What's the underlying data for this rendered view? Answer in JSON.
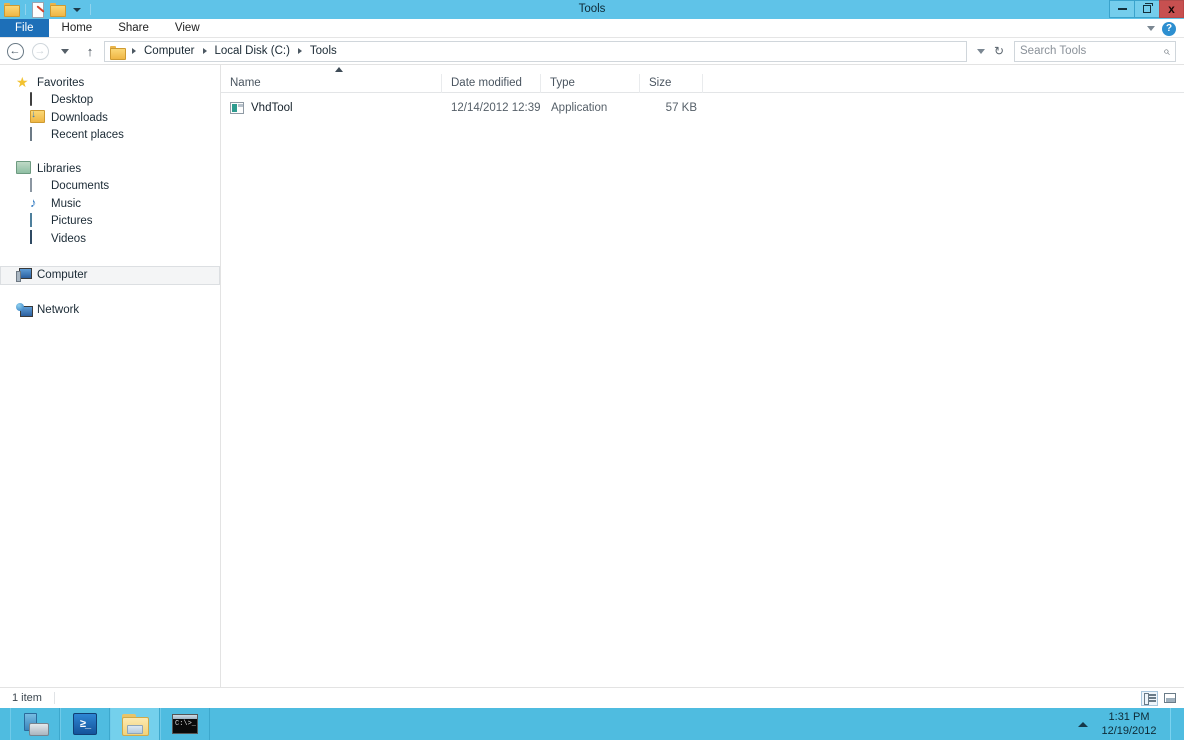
{
  "window": {
    "title": "Tools",
    "quick_access": [
      {
        "name": "folder-icon",
        "label": "Folder"
      },
      {
        "name": "properties-icon",
        "label": "Properties"
      },
      {
        "name": "new-folder-icon",
        "label": "New folder"
      },
      {
        "name": "customize-chevron-icon",
        "label": "Customize Quick Access Toolbar"
      }
    ],
    "controls": {
      "minimize": "—",
      "maximize": "▢",
      "close": "x"
    }
  },
  "ribbon": {
    "tabs": [
      {
        "label": "File",
        "active": true
      },
      {
        "label": "Home",
        "active": false
      },
      {
        "label": "Share",
        "active": false
      },
      {
        "label": "View",
        "active": false
      }
    ],
    "collapse_icon": "chevron-down-icon",
    "help_label": "?"
  },
  "address": {
    "back_label": "←",
    "forward_label": "→",
    "recent_label": "recent-locations-chevron",
    "up_label": "↑",
    "breadcrumbs": [
      "Computer",
      "Local Disk (C:)",
      "Tools"
    ],
    "history_chevron": "⌄",
    "refresh_label": "↻"
  },
  "search": {
    "placeholder": "Search Tools",
    "icon": "⌕"
  },
  "navpane": {
    "groups": [
      {
        "header": {
          "label": "Favorites",
          "icon": "star-icon"
        },
        "items": [
          {
            "label": "Desktop",
            "icon": "desktop-icon"
          },
          {
            "label": "Downloads",
            "icon": "downloads-folder-icon"
          },
          {
            "label": "Recent places",
            "icon": "recent-places-icon"
          }
        ]
      },
      {
        "header": {
          "label": "Libraries",
          "icon": "libraries-icon"
        },
        "items": [
          {
            "label": "Documents",
            "icon": "documents-icon"
          },
          {
            "label": "Music",
            "icon": "music-icon"
          },
          {
            "label": "Pictures",
            "icon": "pictures-icon"
          },
          {
            "label": "Videos",
            "icon": "videos-icon"
          }
        ]
      },
      {
        "header": {
          "label": "Computer",
          "icon": "computer-icon",
          "selected": true
        },
        "items": []
      },
      {
        "header": {
          "label": "Network",
          "icon": "network-icon"
        },
        "items": []
      }
    ]
  },
  "filelist": {
    "columns": [
      {
        "label": "Name",
        "sorted": true,
        "sort_dir": "asc"
      },
      {
        "label": "Date modified"
      },
      {
        "label": "Type"
      },
      {
        "label": "Size"
      }
    ],
    "rows": [
      {
        "name": "VhdTool",
        "icon": "application-icon",
        "date_modified": "12/14/2012 12:39 ...",
        "type": "Application",
        "size": "57 KB"
      }
    ]
  },
  "statusbar": {
    "item_count": "1 item",
    "views": [
      {
        "name": "details-view-button",
        "active": true
      },
      {
        "name": "large-icons-view-button",
        "active": false
      }
    ]
  },
  "taskbar": {
    "items": [
      {
        "name": "server-manager",
        "label": "Server Manager",
        "active": false
      },
      {
        "name": "powershell",
        "label": "Windows PowerShell",
        "active": false
      },
      {
        "name": "file-explorer",
        "label": "File Explorer",
        "active": true
      },
      {
        "name": "command-prompt",
        "label": "Command Prompt",
        "active": false
      }
    ],
    "cmd_text": "C:\\>_",
    "ps_text": "≥_",
    "tray": {
      "expand_label": "▲",
      "time": "1:31 PM",
      "date": "12/19/2012"
    }
  },
  "colors": {
    "titlebar": "#5FC3E8",
    "file_tab": "#1D6FB8",
    "close_button": "#C75050",
    "taskbar": "#4FBCE0"
  }
}
